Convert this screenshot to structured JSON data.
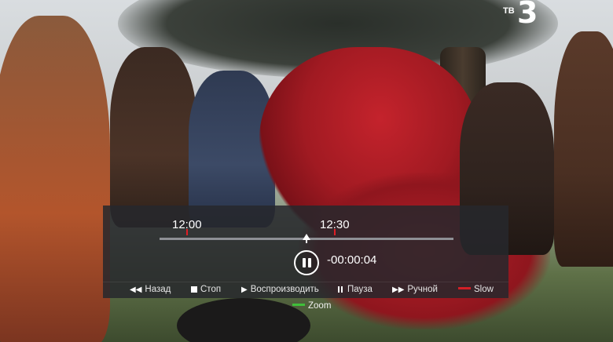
{
  "channel": {
    "logo_prefix": "ТВ",
    "logo_number": "3"
  },
  "player": {
    "time_marks": [
      "12:00",
      "12:30"
    ],
    "offset": "-00:00:04",
    "state": "paused"
  },
  "menu": {
    "items": [
      {
        "label": "Назад",
        "icon": "rewind-icon"
      },
      {
        "label": "Стоп",
        "icon": "stop-icon"
      },
      {
        "label": "Воспроизводить",
        "icon": "play-icon"
      },
      {
        "label": "Пауза",
        "icon": "pause-icon"
      },
      {
        "label": "Ручной",
        "icon": "fast-forward-icon"
      },
      {
        "label": "Slow",
        "icon": "red-key-icon"
      }
    ],
    "extra": {
      "label": "Zoom",
      "icon": "green-key-icon"
    }
  },
  "colors": {
    "tick": "#e01e25",
    "red_key": "#d21f26",
    "green_key": "#3fbf3a"
  }
}
